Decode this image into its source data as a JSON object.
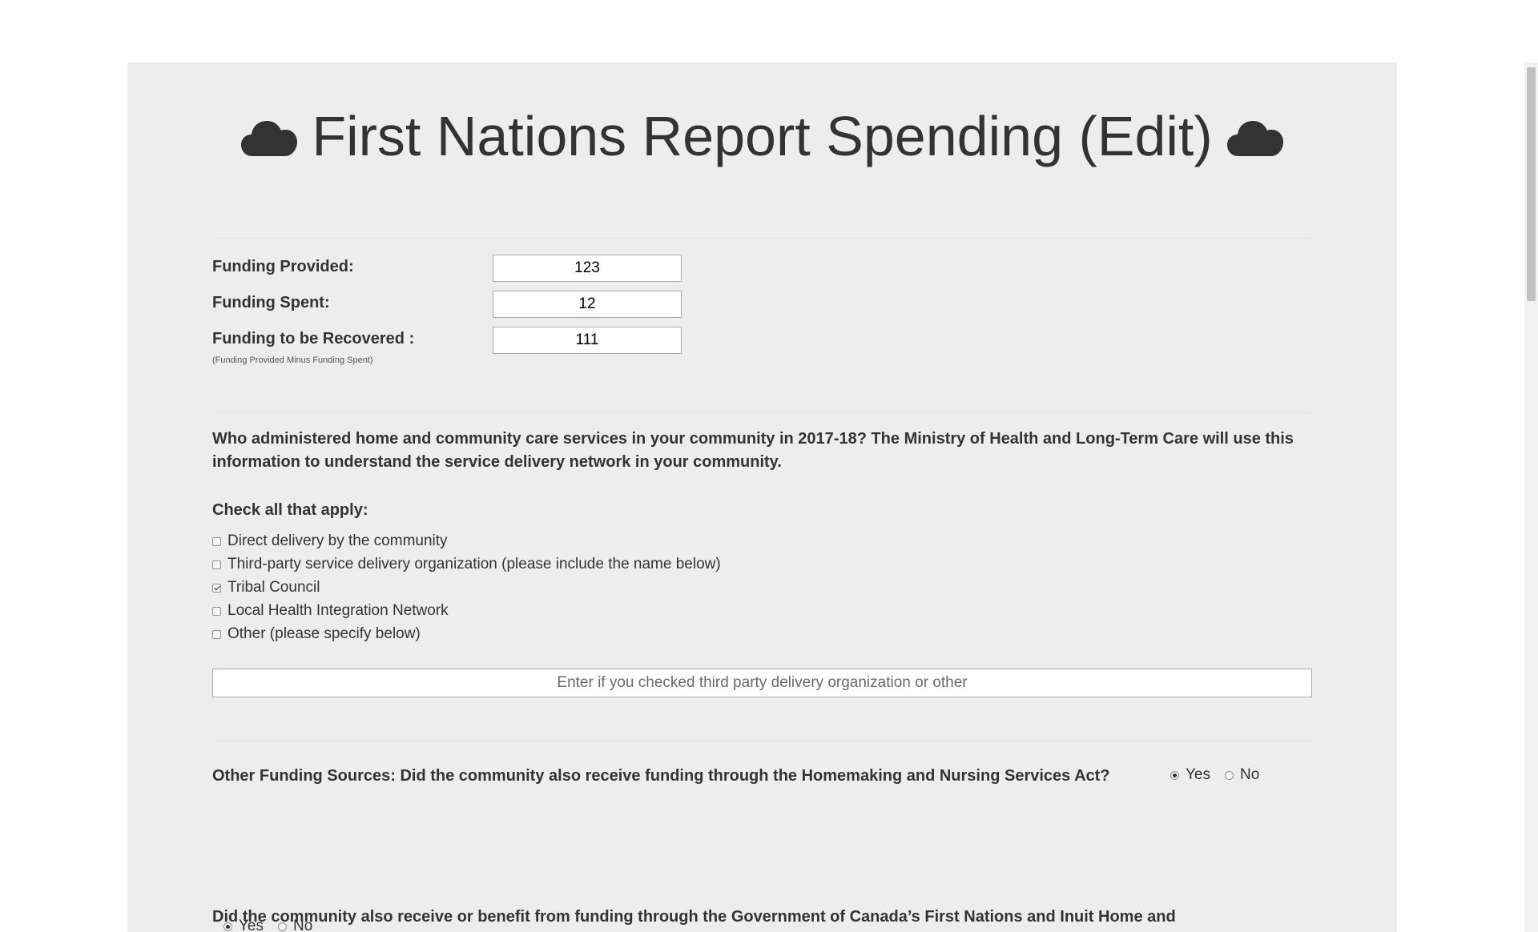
{
  "header": {
    "title": "First Nations Report Spending (Edit)",
    "left_icon": "cloud-icon",
    "right_icon": "cloud-icon"
  },
  "funding": {
    "provided_label": "Funding Provided:",
    "provided_value": "123",
    "spent_label": "Funding Spent:",
    "spent_value": "12",
    "recovered_label": "Funding to be Recovered :",
    "recovered_value": "111",
    "recovered_note": "(Funding Provided Minus Funding Spent)"
  },
  "administered": {
    "question": "Who administered home and community care services in your community in 2017-18? The Ministry of Health and Long-Term Care will use this information to understand the service delivery network in your community.",
    "check_all_label": "Check all that apply:",
    "options": [
      {
        "label": "Direct delivery by the community",
        "checked": false
      },
      {
        "label": "Third-party service delivery organization (please include the name below)",
        "checked": false
      },
      {
        "label": "Tribal Council",
        "checked": true
      },
      {
        "label": "Local Health Integration Network",
        "checked": false
      },
      {
        "label": "Other (please specify below)",
        "checked": false
      }
    ],
    "other_placeholder": "Enter if you checked third party delivery organization or other",
    "other_value": ""
  },
  "other_funding": {
    "question": "Other Funding Sources: Did the community also receive funding through the Homemaking and Nursing Services Act?",
    "yes_label": "Yes",
    "no_label": "No",
    "selected": "Yes"
  },
  "federal_funding": {
    "question": "Did the community also receive or benefit from funding through the Government of Canada’s First Nations and Inuit Home and Community Care program?",
    "yes_label": "Yes",
    "no_label": "No",
    "selected": "Yes"
  }
}
